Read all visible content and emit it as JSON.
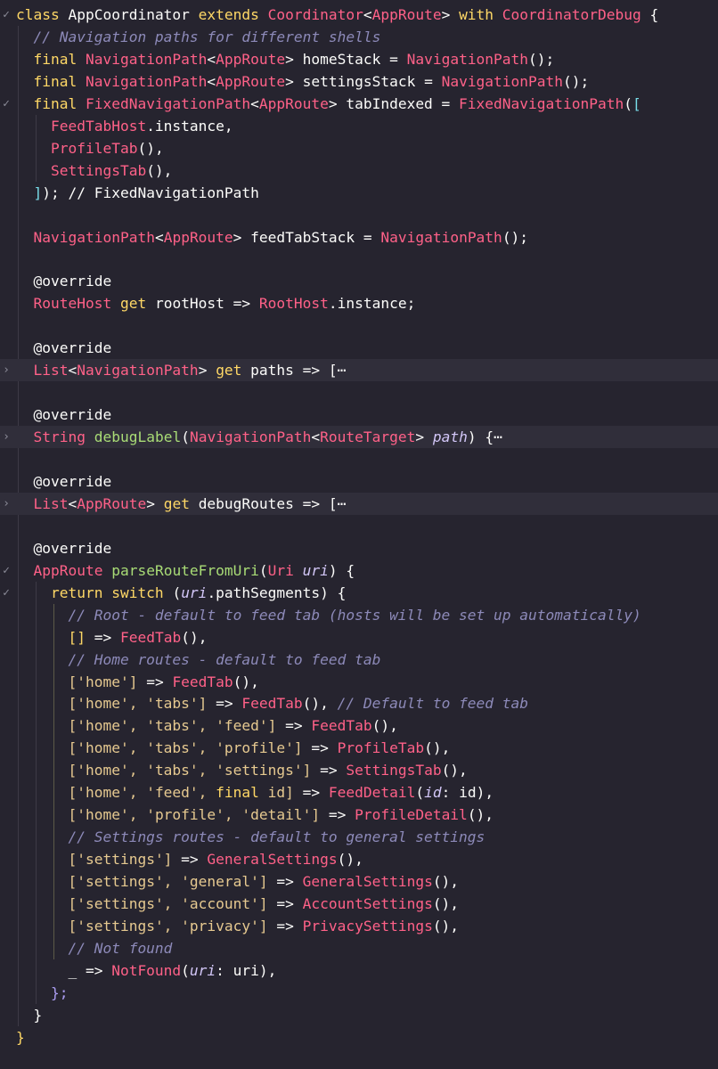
{
  "gutter": {
    "collapse_marker": "✓",
    "expand_marker": "›"
  },
  "lines": [
    [
      {
        "t": "class ",
        "c": "kw"
      },
      {
        "t": "AppCoordinator ",
        "c": "pl"
      },
      {
        "t": "extends ",
        "c": "kw"
      },
      {
        "t": "Coordinator",
        "c": "ty"
      },
      {
        "t": "<",
        "c": "pl"
      },
      {
        "t": "AppRoute",
        "c": "ty"
      },
      {
        "t": "> ",
        "c": "pl"
      },
      {
        "t": "with ",
        "c": "kw"
      },
      {
        "t": "CoordinatorDebug",
        "c": "ty"
      },
      {
        "t": " {",
        "c": "pl"
      }
    ],
    [
      {
        "t": "  // Navigation paths for different shells",
        "c": "cm"
      }
    ],
    [
      {
        "t": "  final ",
        "c": "kw"
      },
      {
        "t": "NavigationPath",
        "c": "ty"
      },
      {
        "t": "<",
        "c": "pl"
      },
      {
        "t": "AppRoute",
        "c": "ty"
      },
      {
        "t": "> homeStack = ",
        "c": "pl"
      },
      {
        "t": "NavigationPath",
        "c": "ty"
      },
      {
        "t": "();",
        "c": "pl"
      }
    ],
    [
      {
        "t": "  final ",
        "c": "kw"
      },
      {
        "t": "NavigationPath",
        "c": "ty"
      },
      {
        "t": "<",
        "c": "pl"
      },
      {
        "t": "AppRoute",
        "c": "ty"
      },
      {
        "t": "> settingsStack = ",
        "c": "pl"
      },
      {
        "t": "NavigationPath",
        "c": "ty"
      },
      {
        "t": "();",
        "c": "pl"
      }
    ],
    [
      {
        "t": "  final ",
        "c": "kw"
      },
      {
        "t": "FixedNavigationPath",
        "c": "ty"
      },
      {
        "t": "<",
        "c": "pl"
      },
      {
        "t": "AppRoute",
        "c": "ty"
      },
      {
        "t": "> tabIndexed = ",
        "c": "pl"
      },
      {
        "t": "FixedNavigationPath",
        "c": "ty"
      },
      {
        "t": "(",
        "c": "pl"
      },
      {
        "t": "[",
        "c": "br"
      }
    ],
    [
      {
        "t": "    ",
        "c": "pl"
      },
      {
        "t": "FeedTabHost",
        "c": "ty"
      },
      {
        "t": ".instance,",
        "c": "pl"
      }
    ],
    [
      {
        "t": "    ",
        "c": "pl"
      },
      {
        "t": "ProfileTab",
        "c": "ty"
      },
      {
        "t": "(),",
        "c": "pl"
      }
    ],
    [
      {
        "t": "    ",
        "c": "pl"
      },
      {
        "t": "SettingsTab",
        "c": "ty"
      },
      {
        "t": "(),",
        "c": "pl"
      }
    ],
    [
      {
        "t": "  ",
        "c": "pl"
      },
      {
        "t": "]",
        "c": "br"
      },
      {
        "t": "); // FixedNavigationPath",
        "c": "pl"
      }
    ],
    [],
    [
      {
        "t": "  ",
        "c": "pl"
      },
      {
        "t": "NavigationPath",
        "c": "ty"
      },
      {
        "t": "<",
        "c": "pl"
      },
      {
        "t": "AppRoute",
        "c": "ty"
      },
      {
        "t": "> feedTabStack = ",
        "c": "pl"
      },
      {
        "t": "NavigationPath",
        "c": "ty"
      },
      {
        "t": "();",
        "c": "pl"
      }
    ],
    [],
    [
      {
        "t": "  @override",
        "c": "pl"
      }
    ],
    [
      {
        "t": "  ",
        "c": "pl"
      },
      {
        "t": "RouteHost ",
        "c": "ty"
      },
      {
        "t": "get ",
        "c": "kw"
      },
      {
        "t": "rootHost => ",
        "c": "pl"
      },
      {
        "t": "RootHost",
        "c": "ty"
      },
      {
        "t": ".instance;",
        "c": "pl"
      }
    ],
    [],
    [
      {
        "t": "  @override",
        "c": "pl"
      }
    ],
    [
      {
        "t": "  ",
        "c": "pl"
      },
      {
        "t": "List",
        "c": "ty"
      },
      {
        "t": "<",
        "c": "pl"
      },
      {
        "t": "NavigationPath",
        "c": "ty"
      },
      {
        "t": "> ",
        "c": "pl"
      },
      {
        "t": "get ",
        "c": "kw"
      },
      {
        "t": "paths => [",
        "c": "pl"
      },
      {
        "t": "⋯",
        "c": "pl"
      }
    ],
    [],
    [
      {
        "t": "  @override",
        "c": "pl"
      }
    ],
    [
      {
        "t": "  ",
        "c": "pl"
      },
      {
        "t": "String ",
        "c": "ty"
      },
      {
        "t": "debugLabel",
        "c": "fn"
      },
      {
        "t": "(",
        "c": "pl"
      },
      {
        "t": "NavigationPath",
        "c": "ty"
      },
      {
        "t": "<",
        "c": "pl"
      },
      {
        "t": "RouteTarget",
        "c": "ty"
      },
      {
        "t": "> ",
        "c": "pl"
      },
      {
        "t": "path",
        "c": "it"
      },
      {
        "t": ") {",
        "c": "pl"
      },
      {
        "t": "⋯",
        "c": "pl"
      }
    ],
    [],
    [
      {
        "t": "  @override",
        "c": "pl"
      }
    ],
    [
      {
        "t": "  ",
        "c": "pl"
      },
      {
        "t": "List",
        "c": "ty"
      },
      {
        "t": "<",
        "c": "pl"
      },
      {
        "t": "AppRoute",
        "c": "ty"
      },
      {
        "t": "> ",
        "c": "pl"
      },
      {
        "t": "get ",
        "c": "kw"
      },
      {
        "t": "debugRoutes => [",
        "c": "pl"
      },
      {
        "t": "⋯",
        "c": "pl"
      }
    ],
    [],
    [
      {
        "t": "  @override",
        "c": "pl"
      }
    ],
    [
      {
        "t": "  ",
        "c": "pl"
      },
      {
        "t": "AppRoute ",
        "c": "ty"
      },
      {
        "t": "parseRouteFromUri",
        "c": "fn"
      },
      {
        "t": "(",
        "c": "pl"
      },
      {
        "t": "Uri ",
        "c": "ty"
      },
      {
        "t": "uri",
        "c": "it"
      },
      {
        "t": ") {",
        "c": "pl"
      }
    ],
    [
      {
        "t": "    return switch ",
        "c": "kw"
      },
      {
        "t": "(",
        "c": "pl"
      },
      {
        "t": "uri",
        "c": "it"
      },
      {
        "t": ".pathSegments) {",
        "c": "pl"
      }
    ],
    [
      {
        "t": "      // Root - default to feed tab (hosts will be set up automatically)",
        "c": "cm"
      }
    ],
    [
      {
        "t": "      ",
        "c": "pl"
      },
      {
        "t": "[]",
        "c": "kw"
      },
      {
        "t": " => ",
        "c": "pl"
      },
      {
        "t": "FeedTab",
        "c": "ty"
      },
      {
        "t": "(),",
        "c": "pl"
      }
    ],
    [
      {
        "t": "      // Home routes - default to feed tab",
        "c": "cm"
      }
    ],
    [
      {
        "t": "      ",
        "c": "pl"
      },
      {
        "t": "['home']",
        "c": "str"
      },
      {
        "t": " => ",
        "c": "pl"
      },
      {
        "t": "FeedTab",
        "c": "ty"
      },
      {
        "t": "(),",
        "c": "pl"
      }
    ],
    [
      {
        "t": "      ",
        "c": "pl"
      },
      {
        "t": "['home', 'tabs']",
        "c": "str"
      },
      {
        "t": " => ",
        "c": "pl"
      },
      {
        "t": "FeedTab",
        "c": "ty"
      },
      {
        "t": "(), ",
        "c": "pl"
      },
      {
        "t": "// Default to feed tab",
        "c": "cm"
      }
    ],
    [
      {
        "t": "      ",
        "c": "pl"
      },
      {
        "t": "['home', 'tabs', 'feed']",
        "c": "str"
      },
      {
        "t": " => ",
        "c": "pl"
      },
      {
        "t": "FeedTab",
        "c": "ty"
      },
      {
        "t": "(),",
        "c": "pl"
      }
    ],
    [
      {
        "t": "      ",
        "c": "pl"
      },
      {
        "t": "['home', 'tabs', 'profile']",
        "c": "str"
      },
      {
        "t": " => ",
        "c": "pl"
      },
      {
        "t": "ProfileTab",
        "c": "ty"
      },
      {
        "t": "(),",
        "c": "pl"
      }
    ],
    [
      {
        "t": "      ",
        "c": "pl"
      },
      {
        "t": "['home', 'tabs', 'settings']",
        "c": "str"
      },
      {
        "t": " => ",
        "c": "pl"
      },
      {
        "t": "SettingsTab",
        "c": "ty"
      },
      {
        "t": "(),",
        "c": "pl"
      }
    ],
    [
      {
        "t": "      ",
        "c": "pl"
      },
      {
        "t": "['home', 'feed', ",
        "c": "str"
      },
      {
        "t": "final ",
        "c": "kw"
      },
      {
        "t": "id]",
        "c": "str"
      },
      {
        "t": " => ",
        "c": "pl"
      },
      {
        "t": "FeedDetail",
        "c": "ty"
      },
      {
        "t": "(",
        "c": "pl"
      },
      {
        "t": "id",
        "c": "it"
      },
      {
        "t": ": id),",
        "c": "pl"
      }
    ],
    [
      {
        "t": "      ",
        "c": "pl"
      },
      {
        "t": "['home', 'profile', 'detail']",
        "c": "str"
      },
      {
        "t": " => ",
        "c": "pl"
      },
      {
        "t": "ProfileDetail",
        "c": "ty"
      },
      {
        "t": "(),",
        "c": "pl"
      }
    ],
    [
      {
        "t": "      // Settings routes - default to general settings",
        "c": "cm"
      }
    ],
    [
      {
        "t": "      ",
        "c": "pl"
      },
      {
        "t": "['settings']",
        "c": "str"
      },
      {
        "t": " => ",
        "c": "pl"
      },
      {
        "t": "GeneralSettings",
        "c": "ty"
      },
      {
        "t": "(),",
        "c": "pl"
      }
    ],
    [
      {
        "t": "      ",
        "c": "pl"
      },
      {
        "t": "['settings', 'general']",
        "c": "str"
      },
      {
        "t": " => ",
        "c": "pl"
      },
      {
        "t": "GeneralSettings",
        "c": "ty"
      },
      {
        "t": "(),",
        "c": "pl"
      }
    ],
    [
      {
        "t": "      ",
        "c": "pl"
      },
      {
        "t": "['settings', 'account']",
        "c": "str"
      },
      {
        "t": " => ",
        "c": "pl"
      },
      {
        "t": "AccountSettings",
        "c": "ty"
      },
      {
        "t": "(),",
        "c": "pl"
      }
    ],
    [
      {
        "t": "      ",
        "c": "pl"
      },
      {
        "t": "['settings', 'privacy']",
        "c": "str"
      },
      {
        "t": " => ",
        "c": "pl"
      },
      {
        "t": "PrivacySettings",
        "c": "ty"
      },
      {
        "t": "(),",
        "c": "pl"
      }
    ],
    [
      {
        "t": "      // Not found",
        "c": "cm"
      }
    ],
    [
      {
        "t": "      _ => ",
        "c": "pl"
      },
      {
        "t": "NotFound",
        "c": "ty"
      },
      {
        "t": "(",
        "c": "pl"
      },
      {
        "t": "uri",
        "c": "it"
      },
      {
        "t": ": uri),",
        "c": "pl"
      }
    ],
    [
      {
        "t": "    };",
        "c": "pu"
      }
    ],
    [
      {
        "t": "  }",
        "c": "pl"
      }
    ],
    [
      {
        "t": "}",
        "c": "kw"
      }
    ]
  ],
  "fold_lines": {
    "0": "collapse",
    "4": "collapse",
    "16": "expand",
    "19": "expand",
    "22": "expand",
    "25": "collapse",
    "26": "collapse"
  },
  "highlighted_lines": [
    16,
    19,
    22
  ]
}
